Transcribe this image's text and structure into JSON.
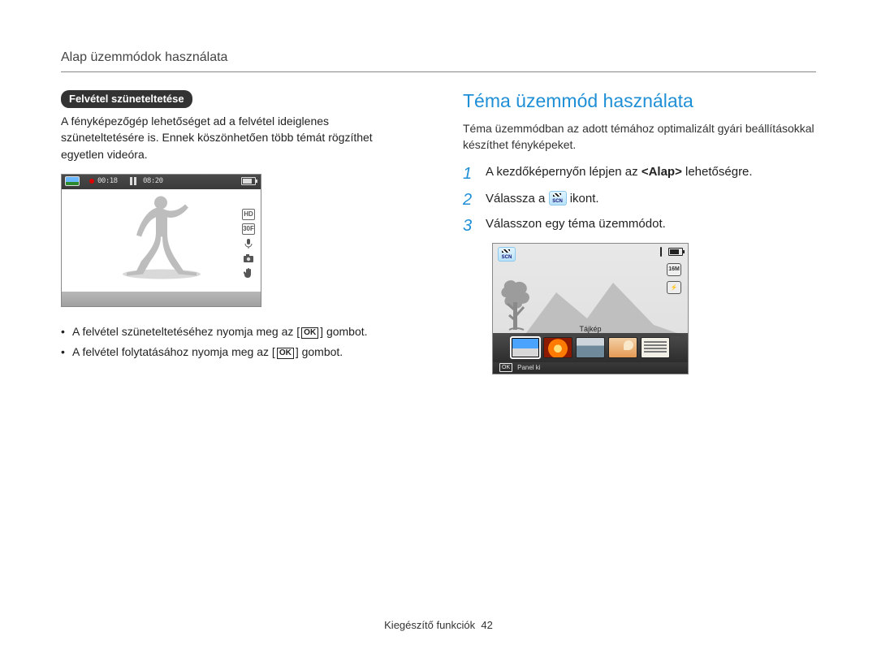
{
  "header": {
    "title": "Alap üzemmódok használata"
  },
  "left": {
    "pill": "Felvétel szüneteltetése",
    "paragraph": "A fényképezőgép lehetőséget ad a felvétel ideiglenes szüneteltetésére is. Ennek köszönhetően több témát rögzíthet egyetlen videóra.",
    "recorder": {
      "time_elapsed": "00:18",
      "time_total": "08:20",
      "right_icons": {
        "hd": "HD",
        "fps": "30F"
      }
    },
    "bullets": {
      "pause_pre": "A felvétel szüneteltetéséhez nyomja meg az [",
      "pause_post": "] gombot.",
      "resume_pre": "A felvétel folytatásához nyomja meg az [",
      "resume_post": "] gombot."
    },
    "ok_label": "OK"
  },
  "right": {
    "heading": "Téma üzemmód használata",
    "intro": "Téma üzemmódban az adott témához optimalizált gyári beállításokkal készíthet fényképeket.",
    "steps": {
      "s1_pre": "A kezdőképernyőn lépjen az ",
      "s1_bold": "<Alap>",
      "s1_post": " lehetőségre.",
      "s2_pre": "Válassza a ",
      "s2_post": " ikont.",
      "s3": "Válasszon egy téma üzemmódot."
    },
    "step_numbers": {
      "n1": "1",
      "n2": "2",
      "n3": "3"
    },
    "scn_label": "SCN",
    "scene_screen": {
      "size_badge": "16M",
      "flash_badge": "⚡",
      "caption": "Tájkép",
      "footer_ok": "OK",
      "footer_text": "Panel ki"
    }
  },
  "footer": {
    "section": "Kiegészítő funkciók",
    "page": "42"
  }
}
